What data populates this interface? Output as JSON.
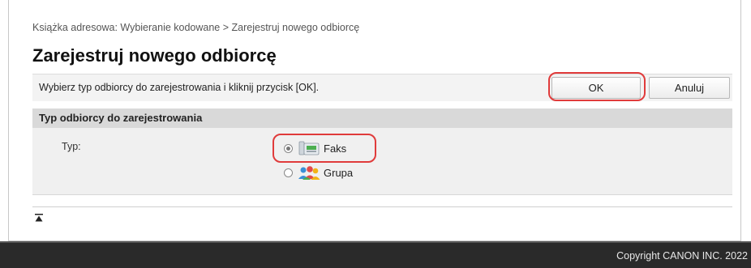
{
  "breadcrumb": "Książka adresowa: Wybieranie kodowane > Zarejestruj nowego odbiorcę",
  "page_title": "Zarejestruj nowego odbiorcę",
  "instruction": "Wybierz typ odbiorcy do zarejestrowania i kliknij przycisk [OK].",
  "buttons": {
    "ok_label": "OK",
    "cancel_label": "Anuluj"
  },
  "section": {
    "header": "Typ odbiorcy do zarejestrowania",
    "field_label": "Typ:",
    "options": [
      {
        "label": "Faks",
        "icon": "fax-icon",
        "selected": true
      },
      {
        "label": "Grupa",
        "icon": "group-icon",
        "selected": false
      }
    ]
  },
  "footer": {
    "copyright": "Copyright CANON INC. 2022"
  },
  "colors": {
    "highlight": "#e03b3b",
    "footer_bg": "#2a2a2a",
    "section_header_bg": "#d9d9d9"
  }
}
